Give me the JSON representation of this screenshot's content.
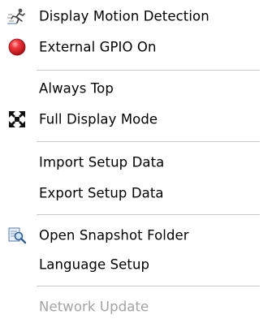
{
  "menu": {
    "items": [
      {
        "label": "Display Motion Detection",
        "icon": "motion-detection-icon",
        "enabled": true
      },
      {
        "label": "External GPIO On",
        "icon": "red-circle-icon",
        "enabled": true
      },
      {
        "label": "Always Top",
        "icon": "",
        "enabled": true
      },
      {
        "label": "Full Display Mode",
        "icon": "fullscreen-arrows-icon",
        "enabled": true
      },
      {
        "label": "Import Setup Data",
        "icon": "",
        "enabled": true
      },
      {
        "label": "Export Setup Data",
        "icon": "",
        "enabled": true
      },
      {
        "label": "Open Snapshot Folder",
        "icon": "snapshot-folder-icon",
        "enabled": true
      },
      {
        "label": "Language Setup",
        "icon": "",
        "enabled": true
      },
      {
        "label": "Network Update",
        "icon": "",
        "enabled": false
      }
    ]
  },
  "colors": {
    "background": "#ffffff",
    "text": "#000000",
    "disabled_text": "#a3a3a3",
    "separator": "#c8c8c8",
    "gpio_red": "#e8242a"
  }
}
